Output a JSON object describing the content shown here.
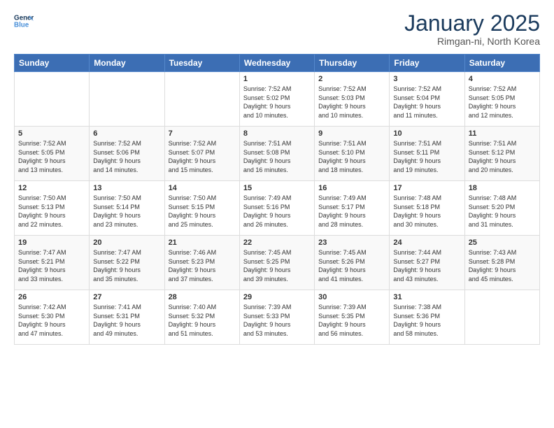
{
  "header": {
    "logo_line1": "General",
    "logo_line2": "Blue",
    "month": "January 2025",
    "location": "Rimgan-ni, North Korea"
  },
  "weekdays": [
    "Sunday",
    "Monday",
    "Tuesday",
    "Wednesday",
    "Thursday",
    "Friday",
    "Saturday"
  ],
  "weeks": [
    [
      {
        "day": "",
        "info": ""
      },
      {
        "day": "",
        "info": ""
      },
      {
        "day": "",
        "info": ""
      },
      {
        "day": "1",
        "info": "Sunrise: 7:52 AM\nSunset: 5:02 PM\nDaylight: 9 hours\nand 10 minutes."
      },
      {
        "day": "2",
        "info": "Sunrise: 7:52 AM\nSunset: 5:03 PM\nDaylight: 9 hours\nand 10 minutes."
      },
      {
        "day": "3",
        "info": "Sunrise: 7:52 AM\nSunset: 5:04 PM\nDaylight: 9 hours\nand 11 minutes."
      },
      {
        "day": "4",
        "info": "Sunrise: 7:52 AM\nSunset: 5:05 PM\nDaylight: 9 hours\nand 12 minutes."
      }
    ],
    [
      {
        "day": "5",
        "info": "Sunrise: 7:52 AM\nSunset: 5:05 PM\nDaylight: 9 hours\nand 13 minutes."
      },
      {
        "day": "6",
        "info": "Sunrise: 7:52 AM\nSunset: 5:06 PM\nDaylight: 9 hours\nand 14 minutes."
      },
      {
        "day": "7",
        "info": "Sunrise: 7:52 AM\nSunset: 5:07 PM\nDaylight: 9 hours\nand 15 minutes."
      },
      {
        "day": "8",
        "info": "Sunrise: 7:51 AM\nSunset: 5:08 PM\nDaylight: 9 hours\nand 16 minutes."
      },
      {
        "day": "9",
        "info": "Sunrise: 7:51 AM\nSunset: 5:10 PM\nDaylight: 9 hours\nand 18 minutes."
      },
      {
        "day": "10",
        "info": "Sunrise: 7:51 AM\nSunset: 5:11 PM\nDaylight: 9 hours\nand 19 minutes."
      },
      {
        "day": "11",
        "info": "Sunrise: 7:51 AM\nSunset: 5:12 PM\nDaylight: 9 hours\nand 20 minutes."
      }
    ],
    [
      {
        "day": "12",
        "info": "Sunrise: 7:50 AM\nSunset: 5:13 PM\nDaylight: 9 hours\nand 22 minutes."
      },
      {
        "day": "13",
        "info": "Sunrise: 7:50 AM\nSunset: 5:14 PM\nDaylight: 9 hours\nand 23 minutes."
      },
      {
        "day": "14",
        "info": "Sunrise: 7:50 AM\nSunset: 5:15 PM\nDaylight: 9 hours\nand 25 minutes."
      },
      {
        "day": "15",
        "info": "Sunrise: 7:49 AM\nSunset: 5:16 PM\nDaylight: 9 hours\nand 26 minutes."
      },
      {
        "day": "16",
        "info": "Sunrise: 7:49 AM\nSunset: 5:17 PM\nDaylight: 9 hours\nand 28 minutes."
      },
      {
        "day": "17",
        "info": "Sunrise: 7:48 AM\nSunset: 5:18 PM\nDaylight: 9 hours\nand 30 minutes."
      },
      {
        "day": "18",
        "info": "Sunrise: 7:48 AM\nSunset: 5:20 PM\nDaylight: 9 hours\nand 31 minutes."
      }
    ],
    [
      {
        "day": "19",
        "info": "Sunrise: 7:47 AM\nSunset: 5:21 PM\nDaylight: 9 hours\nand 33 minutes."
      },
      {
        "day": "20",
        "info": "Sunrise: 7:47 AM\nSunset: 5:22 PM\nDaylight: 9 hours\nand 35 minutes."
      },
      {
        "day": "21",
        "info": "Sunrise: 7:46 AM\nSunset: 5:23 PM\nDaylight: 9 hours\nand 37 minutes."
      },
      {
        "day": "22",
        "info": "Sunrise: 7:45 AM\nSunset: 5:25 PM\nDaylight: 9 hours\nand 39 minutes."
      },
      {
        "day": "23",
        "info": "Sunrise: 7:45 AM\nSunset: 5:26 PM\nDaylight: 9 hours\nand 41 minutes."
      },
      {
        "day": "24",
        "info": "Sunrise: 7:44 AM\nSunset: 5:27 PM\nDaylight: 9 hours\nand 43 minutes."
      },
      {
        "day": "25",
        "info": "Sunrise: 7:43 AM\nSunset: 5:28 PM\nDaylight: 9 hours\nand 45 minutes."
      }
    ],
    [
      {
        "day": "26",
        "info": "Sunrise: 7:42 AM\nSunset: 5:30 PM\nDaylight: 9 hours\nand 47 minutes."
      },
      {
        "day": "27",
        "info": "Sunrise: 7:41 AM\nSunset: 5:31 PM\nDaylight: 9 hours\nand 49 minutes."
      },
      {
        "day": "28",
        "info": "Sunrise: 7:40 AM\nSunset: 5:32 PM\nDaylight: 9 hours\nand 51 minutes."
      },
      {
        "day": "29",
        "info": "Sunrise: 7:39 AM\nSunset: 5:33 PM\nDaylight: 9 hours\nand 53 minutes."
      },
      {
        "day": "30",
        "info": "Sunrise: 7:39 AM\nSunset: 5:35 PM\nDaylight: 9 hours\nand 56 minutes."
      },
      {
        "day": "31",
        "info": "Sunrise: 7:38 AM\nSunset: 5:36 PM\nDaylight: 9 hours\nand 58 minutes."
      },
      {
        "day": "",
        "info": ""
      }
    ]
  ]
}
